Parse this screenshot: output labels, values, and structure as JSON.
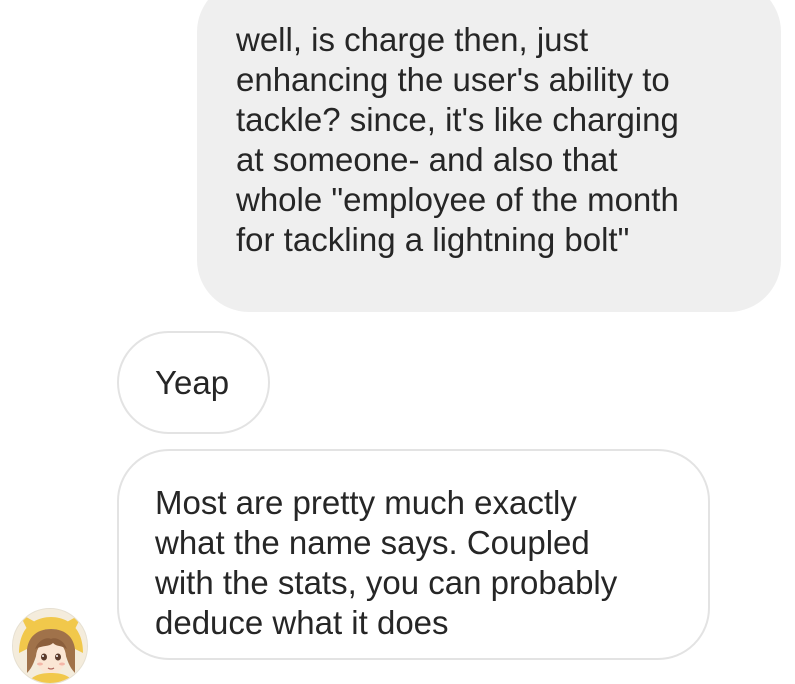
{
  "conversation": {
    "messages": [
      {
        "direction": "sent",
        "text": "well, is charge then, just\nenhancing the user's ability to\ntackle? since, it's like charging\nat someone- and also that\nwhole \"employee of the month\nfor tackling a lightning bolt\""
      },
      {
        "direction": "received",
        "text": "Yeap"
      },
      {
        "direction": "received",
        "text": "Most are pretty much exactly\nwhat the name says. Coupled\nwith the stats, you can probably\ndeduce what it does"
      }
    ]
  },
  "contact": {
    "avatar_icon": "anime-avatar-icon"
  },
  "colors": {
    "sent_bubble_bg": "#efefef",
    "received_bubble_border": "#e3e3e3",
    "text": "#262626"
  }
}
